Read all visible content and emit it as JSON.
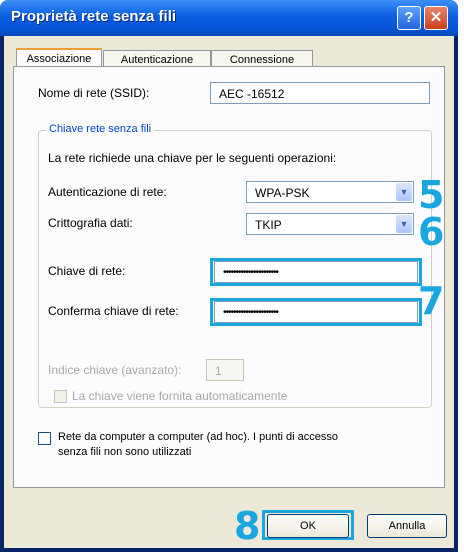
{
  "window": {
    "title": "Proprietà rete senza fili",
    "help_glyph": "?",
    "close_glyph": "✕"
  },
  "tabs": [
    {
      "label": "Associazione",
      "active": true
    },
    {
      "label": "Autenticazione",
      "active": false
    },
    {
      "label": "Connessione",
      "active": false
    }
  ],
  "network": {
    "ssid_label": "Nome di rete (SSID):",
    "ssid_value": "AEC -16512"
  },
  "key_group": {
    "title": "Chiave rete senza fili",
    "description": "La rete richiede una chiave per le seguenti operazioni:",
    "auth_label": "Autenticazione di rete:",
    "auth_value": "WPA-PSK",
    "encryption_label": "Crittografia dati:",
    "encryption_value": "TKIP",
    "key_label": "Chiave di rete:",
    "key_value": "••••••••••••••••••••••",
    "confirm_label": "Conferma chiave di rete:",
    "confirm_value": "••••••••••••••••••••••",
    "index_label": "Indice chiave (avanzato):",
    "index_value": "1",
    "auto_key_label": "La chiave viene fornita automaticamente"
  },
  "adhoc_label_1": "Rete da computer a computer (ad hoc). I punti di accesso",
  "adhoc_label_2": "senza fili non sono utilizzati",
  "buttons": {
    "ok": "OK",
    "cancel": "Annulla"
  },
  "step_numbers": {
    "auth": "5",
    "encryption": "6",
    "key": "7",
    "ok": "8"
  },
  "colors": {
    "highlight": "#1aa6de",
    "titlebar": "#0a5fe0"
  }
}
